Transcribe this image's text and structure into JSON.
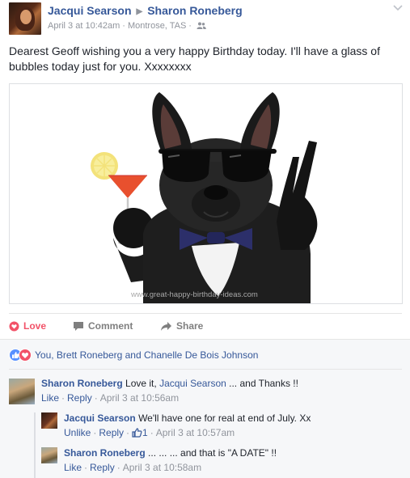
{
  "post": {
    "author": "Jacqui Searson",
    "target": "Sharon Roneberg",
    "timestamp": "April 3 at 10:42am",
    "location": "Montrose, TAS",
    "audience_icon": "friends-icon",
    "text": "Dearest Geoff wishing you a very happy Birthday today. I'll have a glass of bubbles today just for you. Xxxxxxxx",
    "image_watermark": "www.great-happy-birthday-ideas.com"
  },
  "actions": {
    "love_label": "Love",
    "comment_label": "Comment",
    "share_label": "Share"
  },
  "reactions": {
    "summary": "You, Brett Roneberg and Chanelle De Bois Johnson"
  },
  "comments": [
    {
      "author": "Sharon Roneberg",
      "text_prefix": "Love it,",
      "mention": "Jacqui Searson",
      "text_suffix": "... and Thanks !!",
      "action1": "Like",
      "action2": "Reply",
      "time": "April 3 at 10:56am"
    },
    {
      "author": "Jacqui Searson",
      "text": "We'll have one for real at end of July. Xx",
      "action1": "Unlike",
      "action2": "Reply",
      "like_count": "1",
      "time": "April 3 at 10:57am"
    },
    {
      "author": "Sharon Roneberg",
      "text": "... ... ... and that is \"A DATE\" !!",
      "action1": "Like",
      "action2": "Reply",
      "time": "April 3 at 10:58am"
    }
  ],
  "colors": {
    "link": "#365899",
    "meta": "#90949c",
    "love": "#f25268",
    "like": "#5890ff",
    "panel": "#f6f7f9"
  }
}
